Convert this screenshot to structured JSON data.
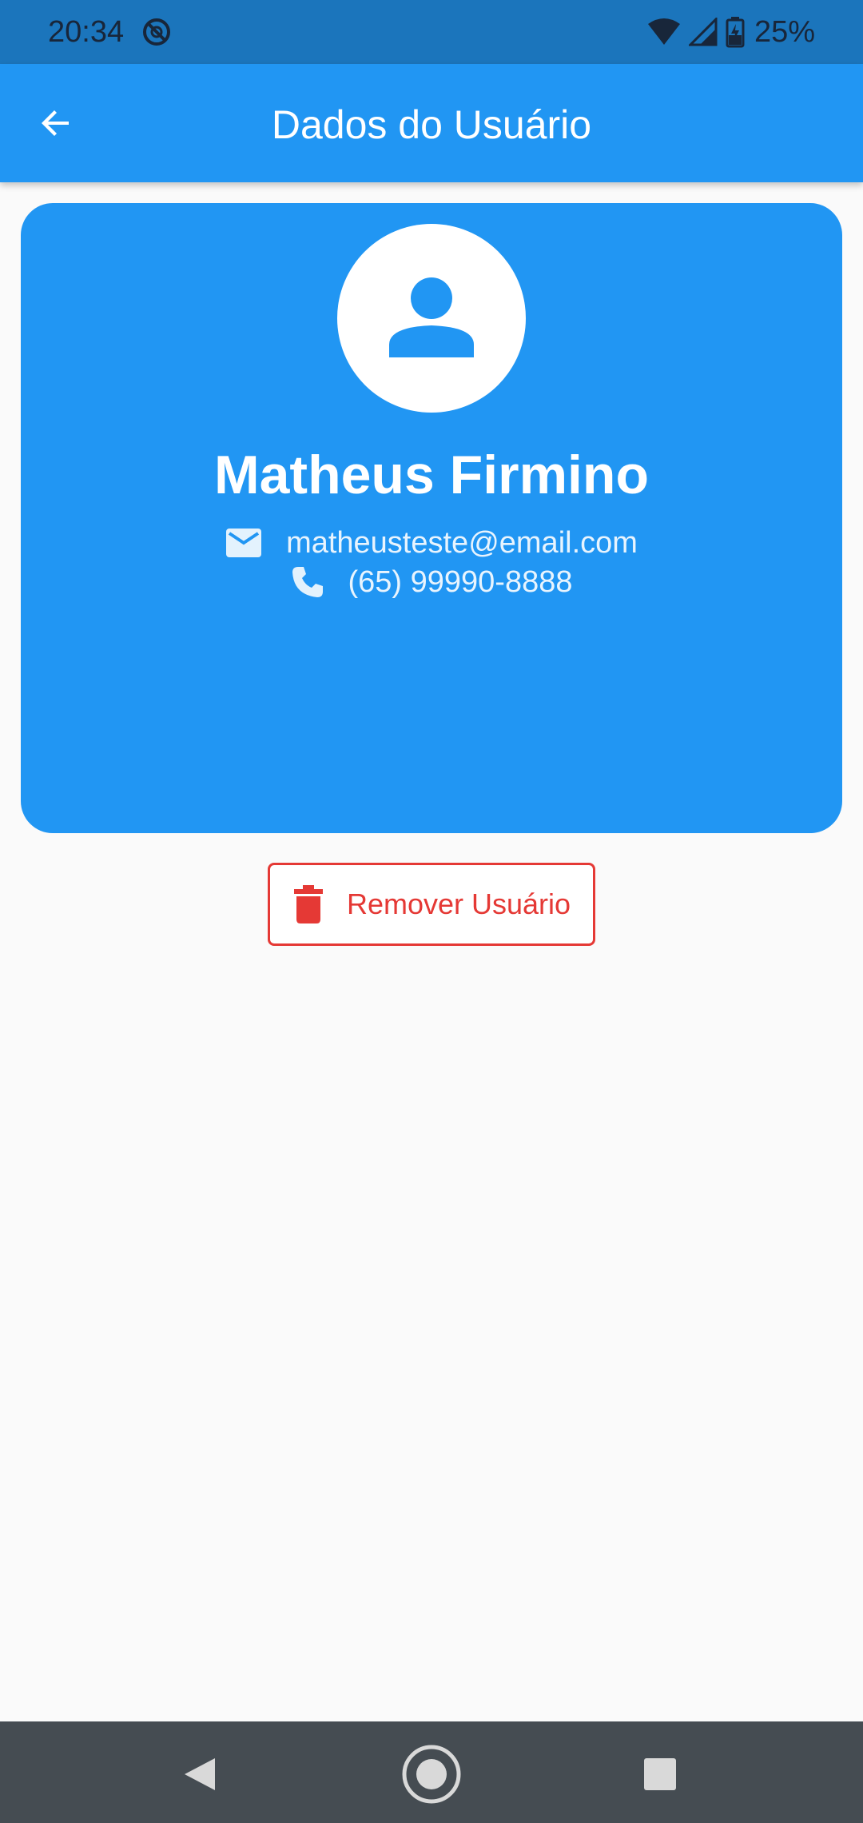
{
  "status_bar": {
    "time": "20:34",
    "battery": "25%",
    "icons": [
      "do-not-disturb-icon",
      "wifi-icon",
      "signal-icon",
      "battery-charging-icon"
    ]
  },
  "app_bar": {
    "title": "Dados do Usuário",
    "back_icon": "arrow-back-icon"
  },
  "profile": {
    "name": "Matheus Firmino",
    "email": "matheusteste@email.com",
    "phone": "(65) 99990-8888",
    "avatar_icon": "person-icon",
    "email_icon": "email-icon",
    "phone_icon": "phone-icon"
  },
  "actions": {
    "remove_label": "Remover Usuário",
    "remove_icon": "trash-icon"
  },
  "nav_bar": {
    "icons": [
      "back-triangle-icon",
      "home-circle-icon",
      "recents-square-icon"
    ]
  },
  "colors": {
    "primary": "#2196F3",
    "status_bar": "#1B75BC",
    "danger": "#E53935",
    "background": "#FAFAFA",
    "nav_bar": "#454C52"
  }
}
